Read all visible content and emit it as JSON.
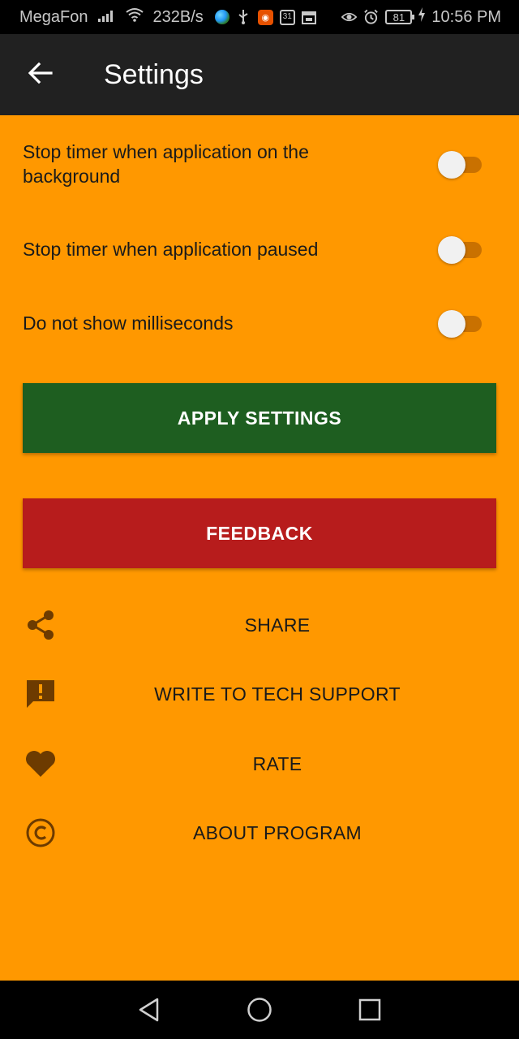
{
  "status_bar": {
    "carrier": "MegaFon",
    "net_speed": "232B/s",
    "calendar_day": "31",
    "battery": "81",
    "time": "10:56 PM"
  },
  "app_bar": {
    "title": "Settings"
  },
  "settings": [
    {
      "label": "Stop timer when application on the background",
      "enabled": false
    },
    {
      "label": "Stop timer when application paused",
      "enabled": false
    },
    {
      "label": "Do not show milliseconds",
      "enabled": false
    }
  ],
  "buttons": {
    "apply": "APPLY SETTINGS",
    "feedback": "FEEDBACK"
  },
  "menu": [
    {
      "label": "SHARE",
      "icon": "share-icon"
    },
    {
      "label": "WRITE TO TECH SUPPORT",
      "icon": "feedback-icon"
    },
    {
      "label": "RATE",
      "icon": "heart-icon"
    },
    {
      "label": "ABOUT PROGRAM",
      "icon": "copyright-icon"
    }
  ],
  "colors": {
    "background": "#ff9800",
    "app_bar": "#212121",
    "apply_button": "#1e5e20",
    "feedback_button": "#b71c1c",
    "icon": "#6d3b00"
  }
}
